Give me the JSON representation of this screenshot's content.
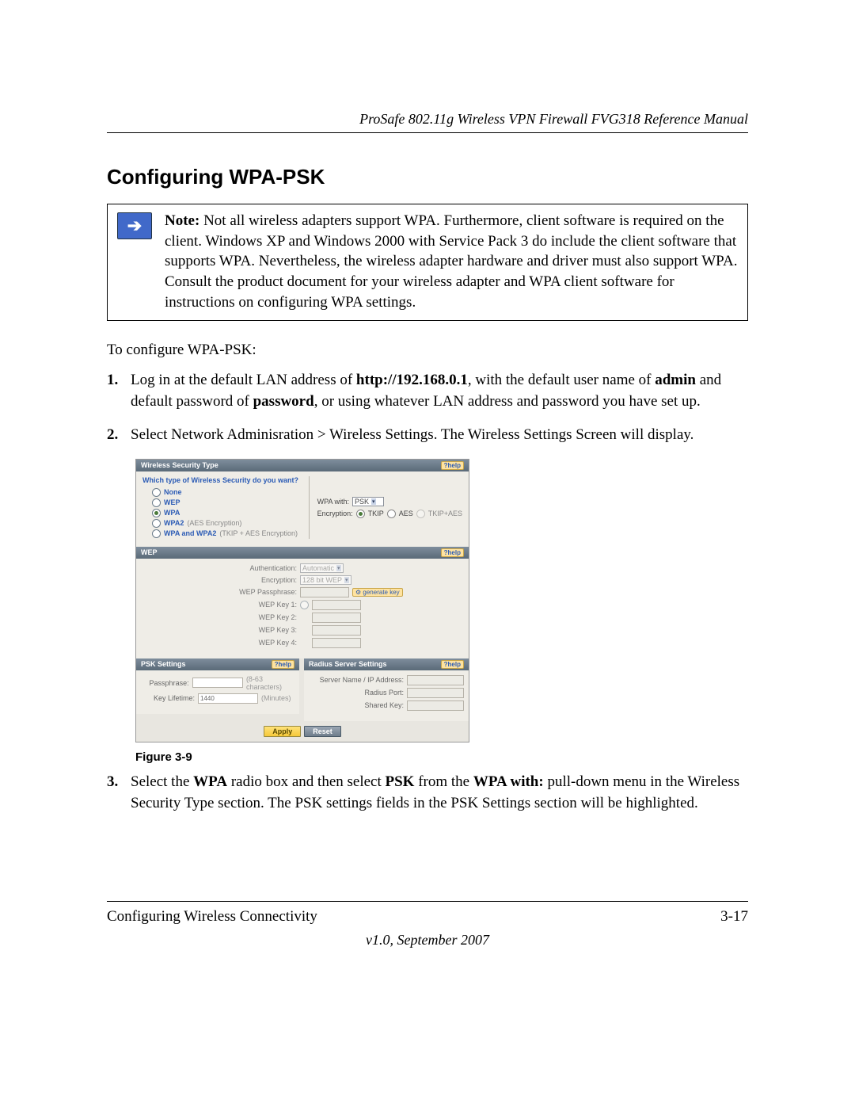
{
  "header": {
    "title": "ProSafe 802.11g Wireless VPN Firewall FVG318 Reference Manual"
  },
  "section_title": "Configuring WPA-PSK",
  "note": {
    "label": "Note:",
    "text": "Not all wireless adapters support WPA. Furthermore, client software is required on the client. Windows XP and Windows 2000 with Service Pack 3 do include the client software that supports WPA. Nevertheless, the wireless adapter hardware and driver must also support WPA. Consult the product document for your wireless adapter and WPA client software for instructions on configuring WPA settings."
  },
  "intro": "To configure WPA-PSK:",
  "steps": {
    "s1_a": "Log in at the default LAN address of ",
    "s1_b": "http://192.168.0.1",
    "s1_c": ", with the default user name of ",
    "s1_d": "admin",
    "s1_e": " and default password of ",
    "s1_f": "password",
    "s1_g": ", or using whatever LAN address and password you have set up.",
    "s2": "Select Network Adminisration > Wireless Settings. The Wireless Settings Screen will display.",
    "s3_a": "Select the ",
    "s3_b": "WPA",
    "s3_c": " radio box and then select ",
    "s3_d": "PSK",
    "s3_e": " from the ",
    "s3_f": "WPA with:",
    "s3_g": " pull-down menu in the Wireless Security Type section. The PSK settings fields in the PSK Settings section will be highlighted."
  },
  "fig_caption": "Figure 3-9",
  "ui": {
    "help": "help",
    "sectype": {
      "title": "Wireless Security Type",
      "question": "Which type of Wireless Security do you want?",
      "opts": {
        "none": "None",
        "wep": "WEP",
        "wpa": "WPA",
        "wpa2": "WPA2",
        "wpa2_hint": "(AES Encryption)",
        "both": "WPA and WPA2",
        "both_hint": "(TKIP + AES Encryption)"
      },
      "wpa_with_label": "WPA with:",
      "wpa_with_value": "PSK",
      "enc_label": "Encryption:",
      "enc": {
        "tkip": "TKIP",
        "aes": "AES",
        "both": "TKIP+AES"
      }
    },
    "wep": {
      "title": "WEP",
      "auth_label": "Authentication:",
      "auth_value": "Automatic",
      "enc_label": "Encryption:",
      "enc_value": "128 bit WEP",
      "pass_label": "WEP Passphrase:",
      "gen": "generate key",
      "k1": "WEP Key 1:",
      "k2": "WEP Key 2:",
      "k3": "WEP Key 3:",
      "k4": "WEP Key 4:"
    },
    "psk": {
      "title": "PSK Settings",
      "pass_label": "Passphrase:",
      "pass_hint": "(8-63 characters)",
      "life_label": "Key Lifetime:",
      "life_value": "1440",
      "life_unit": "(Minutes)"
    },
    "radius": {
      "title": "Radius Server Settings",
      "ip_label": "Server Name / IP Address:",
      "port_label": "Radius Port:",
      "key_label": "Shared Key:"
    },
    "buttons": {
      "apply": "Apply",
      "reset": "Reset"
    }
  },
  "footer": {
    "left": "Configuring Wireless Connectivity",
    "right": "3-17",
    "version": "v1.0, September 2007"
  }
}
